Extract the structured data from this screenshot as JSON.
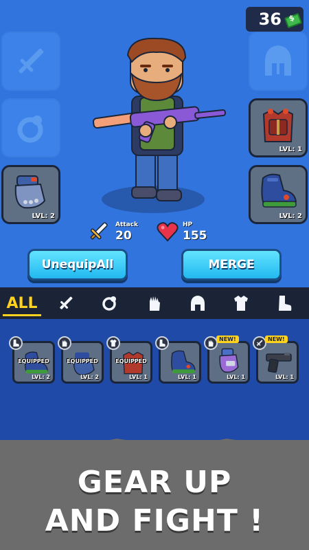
{
  "currency": {
    "amount": "36",
    "icon": "cash-icon"
  },
  "left_slots": [
    {
      "icon": "sword-icon",
      "state": "empty"
    },
    {
      "icon": "ring-icon",
      "state": "empty"
    },
    {
      "icon": "glove-icon",
      "state": "equipped",
      "level": "LVL: 2"
    }
  ],
  "right_slots": [
    {
      "icon": "helmet-icon",
      "state": "empty"
    },
    {
      "icon": "armor-vest-icon",
      "state": "equipped",
      "level": "LVL: 1"
    },
    {
      "icon": "boot-icon",
      "state": "equipped",
      "level": "LVL: 2"
    }
  ],
  "stats": {
    "attack_label": "Attack",
    "attack_value": "20",
    "hp_label": "HP",
    "hp_value": "155"
  },
  "buttons": {
    "unequip_all": "UnequipAll",
    "merge": "MERGE"
  },
  "tabs": [
    {
      "label": "ALL",
      "active": true
    },
    {
      "icon": "sword-icon"
    },
    {
      "icon": "ring-icon"
    },
    {
      "icon": "glove-icon"
    },
    {
      "icon": "helmet-icon"
    },
    {
      "icon": "armor-icon"
    },
    {
      "icon": "boot-icon"
    }
  ],
  "inventory": [
    {
      "type_icon": "boot-icon",
      "item_icon": "boot-icon",
      "equipped": "EQUIPPED",
      "level": "LVL: 2"
    },
    {
      "type_icon": "glove-icon",
      "item_icon": "glove-icon",
      "equipped": "EQUIPPED",
      "level": "LVL: 2"
    },
    {
      "type_icon": "armor-icon",
      "item_icon": "armor-vest-icon",
      "equipped": "EQUIPPED",
      "level": "LVL: 1"
    },
    {
      "type_icon": "boot-icon",
      "item_icon": "boot-icon",
      "level": "LVL: 1"
    },
    {
      "type_icon": "glove-icon",
      "item_icon": "glove-icon",
      "new": "NEW!",
      "level": "LVL: 1"
    },
    {
      "type_icon": "sword-icon",
      "item_icon": "pistol-icon",
      "new": "NEW!",
      "level": "LVL: 1"
    }
  ],
  "banner": {
    "line1": "GEAR UP",
    "line2": "AND FIGHT !"
  },
  "colors": {
    "background": "#3174dd",
    "tab_accent": "#ffd21e",
    "button": "#22b8f0",
    "banner": "#6c6c6c"
  }
}
